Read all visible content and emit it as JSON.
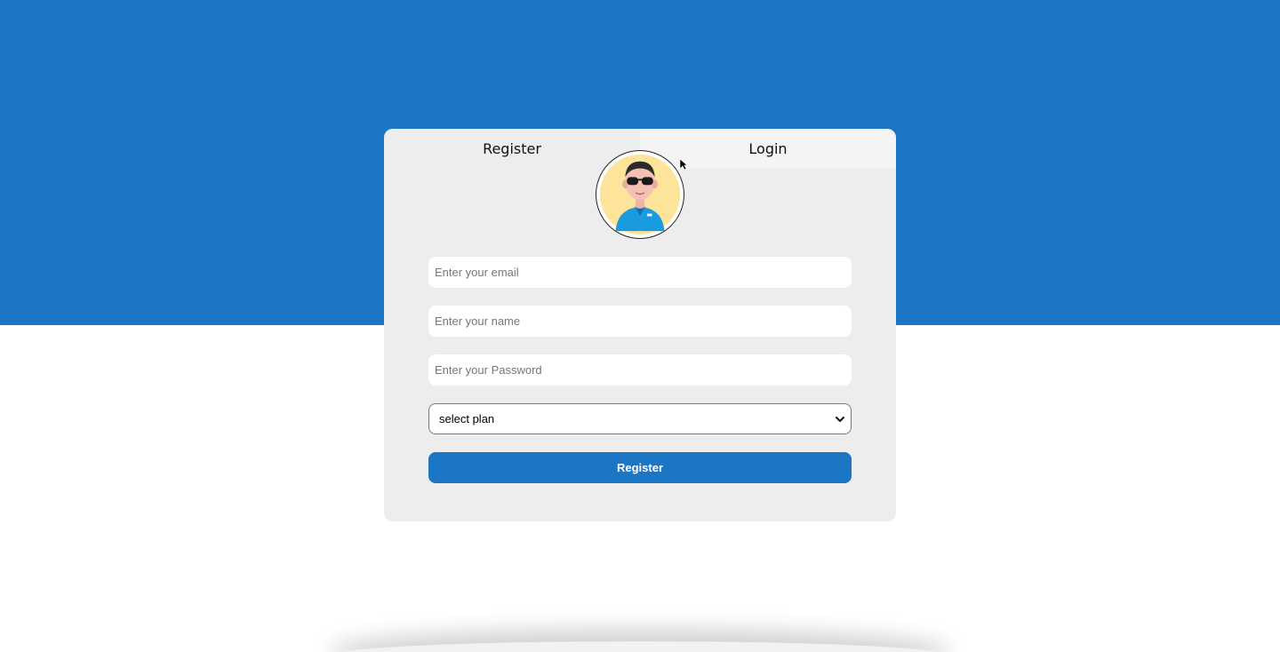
{
  "tabs": {
    "register_label": "Register",
    "login_label": "Login"
  },
  "avatar": {
    "icon": "avatar-icon"
  },
  "form": {
    "email_placeholder": "Enter your email",
    "name_placeholder": "Enter your name",
    "password_placeholder": "Enter your Password",
    "plan_selected": "select plan",
    "submit_label": "Register"
  },
  "colors": {
    "accent": "#1b77c6",
    "card_bg": "#ededed",
    "page_bg": "#ffffff"
  }
}
